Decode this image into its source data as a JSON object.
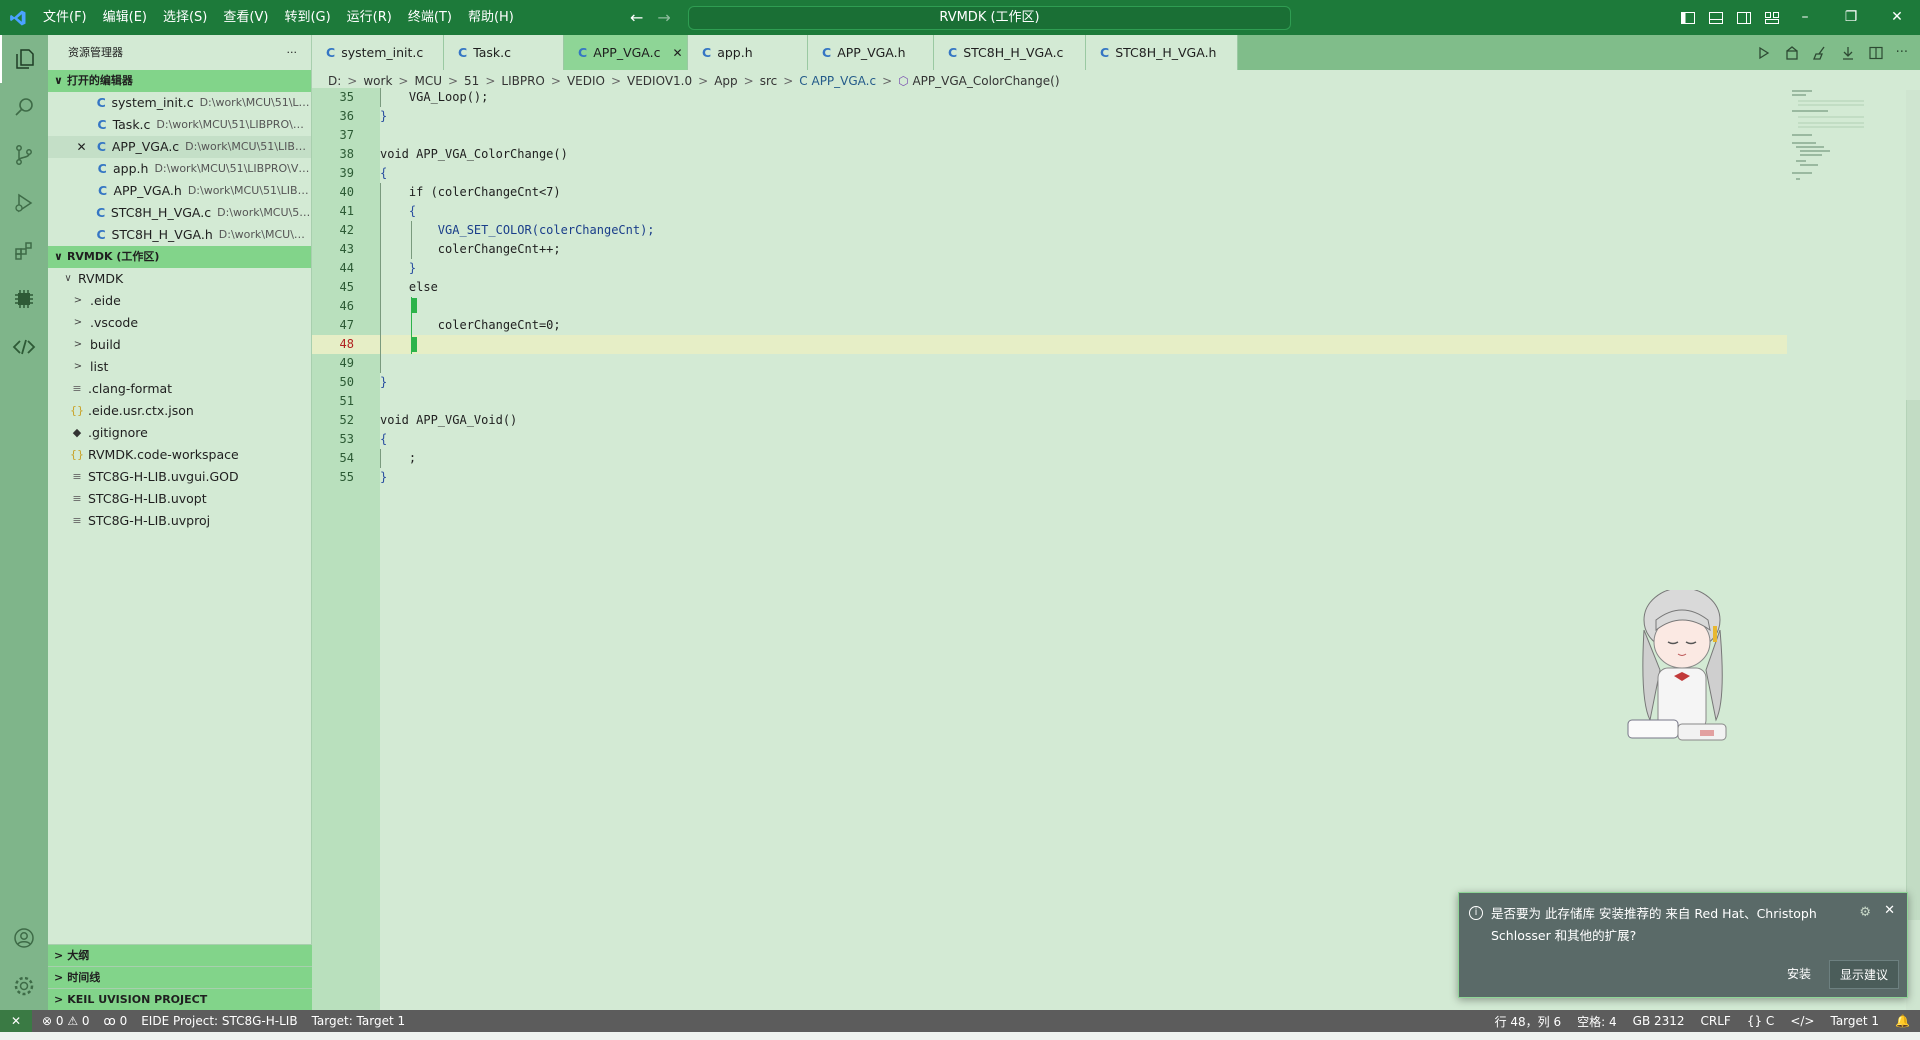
{
  "titlebar": {
    "menu": [
      "文件(F)",
      "编辑(E)",
      "选择(S)",
      "查看(V)",
      "转到(G)",
      "运行(R)",
      "终端(T)",
      "帮助(H)"
    ],
    "command_center": "RVMDK (工作区)"
  },
  "sidebar": {
    "title": "资源管理器",
    "more": "···",
    "open_editors_header": "打开的编辑器",
    "open_editors": [
      {
        "type": "C",
        "name": "system_init.c",
        "path": "D:\\work\\MCU\\51\\LIB..."
      },
      {
        "type": "C",
        "name": "Task.c",
        "path": "D:\\work\\MCU\\51\\LIBPRO\\VE..."
      },
      {
        "type": "C",
        "name": "APP_VGA.c",
        "path": "D:\\work\\MCU\\51\\LIBPR...",
        "close": "✕"
      },
      {
        "type": "C",
        "name": "app.h",
        "path": "D:\\work\\MCU\\51\\LIBPRO\\VE..."
      },
      {
        "type": "C",
        "name": "APP_VGA.h",
        "path": "D:\\work\\MCU\\51\\LIBP..."
      },
      {
        "type": "C",
        "name": "STC8H_H_VGA.c",
        "path": "D:\\work\\MCU\\51\\..."
      },
      {
        "type": "C",
        "name": "STC8H_H_VGA.h",
        "path": "D:\\work\\MCU\\51..."
      }
    ],
    "workspace_header": "RVMDK (工作区)",
    "tree": [
      {
        "label": "RVMDK",
        "twisty": "∨",
        "icon": ""
      },
      {
        "label": ".eide",
        "twisty": ">",
        "icon": ""
      },
      {
        "label": ".vscode",
        "twisty": ">",
        "icon": ""
      },
      {
        "label": "build",
        "twisty": ">",
        "icon": ""
      },
      {
        "label": "list",
        "twisty": ">",
        "icon": ""
      },
      {
        "label": ".clang-format",
        "twisty": "",
        "icon": "≡"
      },
      {
        "label": ".eide.usr.ctx.json",
        "twisty": "",
        "icon": "{}"
      },
      {
        "label": ".gitignore",
        "twisty": "",
        "icon": "◆"
      },
      {
        "label": "RVMDK.code-workspace",
        "twisty": "",
        "icon": "{}"
      },
      {
        "label": "STC8G-H-LIB.uvgui.GOD",
        "twisty": "",
        "icon": "≡"
      },
      {
        "label": "STC8G-H-LIB.uvopt",
        "twisty": "",
        "icon": "≡"
      },
      {
        "label": "STC8G-H-LIB.uvproj",
        "twisty": "",
        "icon": "≡"
      }
    ],
    "bottom_sections": [
      "大纲",
      "时间线",
      "KEIL UVISION PROJECT"
    ]
  },
  "tabs": [
    {
      "type": "C",
      "name": "system_init.c"
    },
    {
      "type": "C",
      "name": "Task.c"
    },
    {
      "type": "C",
      "name": "APP_VGA.c",
      "close": "✕"
    },
    {
      "type": "C",
      "name": "app.h"
    },
    {
      "type": "C",
      "name": "APP_VGA.h"
    },
    {
      "type": "C",
      "name": "STC8H_H_VGA.c"
    },
    {
      "type": "C",
      "name": "STC8H_H_VGA.h"
    }
  ],
  "breadcrumb": [
    "D:",
    "work",
    "MCU",
    "51",
    "LIBPRO",
    "VEDIO",
    "VEDIOV1.0",
    "App",
    "src",
    "C APP_VGA.c",
    "APP_VGA_ColorChange()"
  ],
  "editor": {
    "current_line": "48",
    "lines": [
      {
        "n": "35",
        "code": "    VGA_Loop();"
      },
      {
        "n": "36",
        "code": "}"
      },
      {
        "n": "37",
        "code": ""
      },
      {
        "n": "38",
        "code": "void APP_VGA_ColorChange()"
      },
      {
        "n": "39",
        "code": "{"
      },
      {
        "n": "40",
        "code": "    if (colerChangeCnt<7)"
      },
      {
        "n": "41",
        "code": "    {"
      },
      {
        "n": "42",
        "code": "        VGA_SET_COLOR(colerChangeCnt);"
      },
      {
        "n": "43",
        "code": "        colerChangeCnt++;"
      },
      {
        "n": "44",
        "code": "    }"
      },
      {
        "n": "45",
        "code": "    else"
      },
      {
        "n": "46",
        "code": ""
      },
      {
        "n": "47",
        "code": "        colerChangeCnt=0;"
      },
      {
        "n": "48",
        "code": ""
      },
      {
        "n": "49",
        "code": ""
      },
      {
        "n": "50",
        "code": "}"
      },
      {
        "n": "51",
        "code": ""
      },
      {
        "n": "52",
        "code": "void APP_VGA_Void()"
      },
      {
        "n": "53",
        "code": "{"
      },
      {
        "n": "54",
        "code": "    ;"
      },
      {
        "n": "55",
        "code": "}"
      }
    ]
  },
  "notification": {
    "message": "是否要为 此存储库 安装推荐的 来自 Red Hat、Christoph Schlosser 和其他的扩展?",
    "install": "安装",
    "show_recommendations": "显示建议"
  },
  "statusbar": {
    "remote": "✕",
    "problems": "⊗ 0 ⚠ 0",
    "ports": "ꝏ 0",
    "project": "EIDE Project: STC8G-H-LIB",
    "target": "Target: Target 1",
    "position": "行 48，列 6",
    "spaces": "空格: 4",
    "encoding": "GB 2312",
    "eol": "CRLF",
    "language": "{} C",
    "target_right": "Target 1"
  },
  "colors": {
    "titlebar": "#1d7a3a",
    "activity_bar": "#7fb58a",
    "editor_bg": "#d3ead4",
    "active_tab": "#8ed596",
    "statusbar": "#5c5c5c"
  }
}
